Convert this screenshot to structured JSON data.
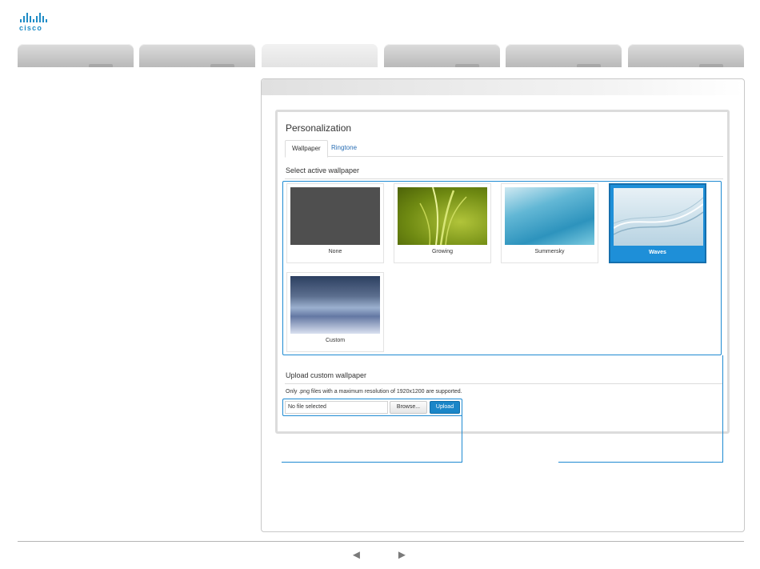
{
  "brand": {
    "logo_text": "cisco",
    "color": "#1f8cc6"
  },
  "nav": {
    "tabs": [
      "",
      "",
      "",
      "",
      "",
      ""
    ],
    "active_index": 2
  },
  "card": {
    "title": "Personalization",
    "tabs": [
      {
        "label": "Wallpaper",
        "active": true
      },
      {
        "label": "Ringtone",
        "active": false
      }
    ]
  },
  "wallpaper": {
    "section_label": "Select active wallpaper",
    "items": [
      {
        "name": "None",
        "selected": false
      },
      {
        "name": "Growing",
        "selected": false
      },
      {
        "name": "Summersky",
        "selected": false
      },
      {
        "name": "Waves",
        "selected": true
      },
      {
        "name": "Custom",
        "selected": false
      }
    ]
  },
  "upload": {
    "section_label": "Upload custom wallpaper",
    "hint": "Only .png files with a maximum resolution of 1920x1200 are supported.",
    "file_value": "No file selected",
    "browse_label": "Browse...",
    "upload_label": "Upload"
  },
  "footer": {
    "prev_icon": "◄",
    "next_icon": "►"
  },
  "colors": {
    "accent": "#1e8ad2",
    "selected_bg": "#1e8fd8"
  }
}
